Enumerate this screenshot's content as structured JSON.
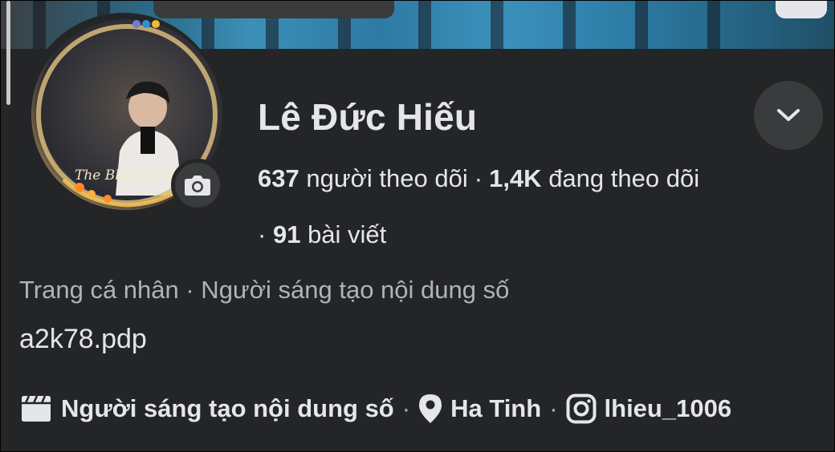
{
  "profile": {
    "name": "Lê Đức Hiếu",
    "followers_count": "637",
    "followers_label": "người theo dõi",
    "following_count": "1,4K",
    "following_label": "đang theo dõi",
    "posts_count": "91",
    "posts_label": "bài viết",
    "separator": "·",
    "category_line": "Trang cá nhân · Người sáng tạo nội dung số",
    "username": "a2k78.pdp"
  },
  "details": {
    "creator_label": "Người sáng tạo nội dung số",
    "location": "Ha Tinh",
    "instagram": "lhieu_1006",
    "separator": "·"
  },
  "avatar": {
    "overlay_text": "The Blazing Tra"
  },
  "icons": {
    "camera": "camera-icon",
    "dropdown": "chevron-down-icon",
    "creator": "clapperboard-icon",
    "location": "map-pin-icon",
    "instagram": "instagram-icon"
  },
  "colors": {
    "background": "#242526",
    "text_primary": "#e4e6eb",
    "text_secondary": "#b0b3b8",
    "button_bg": "#3a3b3c"
  }
}
